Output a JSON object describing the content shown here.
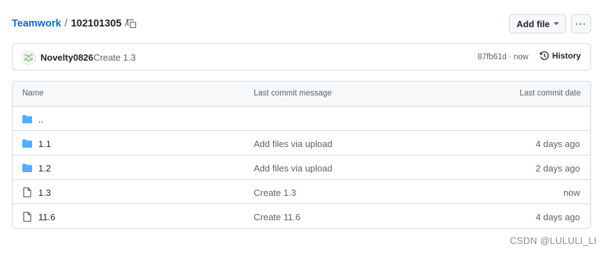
{
  "breadcrumb": {
    "repo": "Teamwork",
    "separator": "/",
    "path": "102101305",
    "trailing": "/"
  },
  "icons": {
    "copy": "copy-path-icon",
    "caret": "triangle-down-icon",
    "more": "kebab-horizontal-icon",
    "history": "history-clock-icon",
    "folder": "folder-icon",
    "file": "file-icon"
  },
  "toolbar": {
    "add_file_label": "Add file",
    "more_label": "···"
  },
  "latest_commit": {
    "author": "Novelty0826",
    "message": "Create 1.3",
    "sha": "87fb61d",
    "separator": "·",
    "time": "now",
    "history_label": "History"
  },
  "table": {
    "headers": {
      "name": "Name",
      "message": "Last commit message",
      "date": "Last commit date"
    },
    "rows": [
      {
        "type": "parent",
        "name": "..",
        "message": "",
        "date": ""
      },
      {
        "type": "folder",
        "name": "1.1",
        "message": "Add files via upload",
        "date": "4 days ago"
      },
      {
        "type": "folder",
        "name": "1.2",
        "message": "Add files via upload",
        "date": "2 days ago"
      },
      {
        "type": "file",
        "name": "1.3",
        "message": "Create 1.3",
        "date": "now"
      },
      {
        "type": "file",
        "name": "11.6",
        "message": "Create 11.6",
        "date": "4 days ago"
      }
    ]
  },
  "watermark": "CSDN @LULULI_LI",
  "colors": {
    "link": "#0969da",
    "folder": "#54aeff",
    "muted": "#59636e",
    "border": "#d1d9e0",
    "header_bg": "#f6f8fa"
  }
}
